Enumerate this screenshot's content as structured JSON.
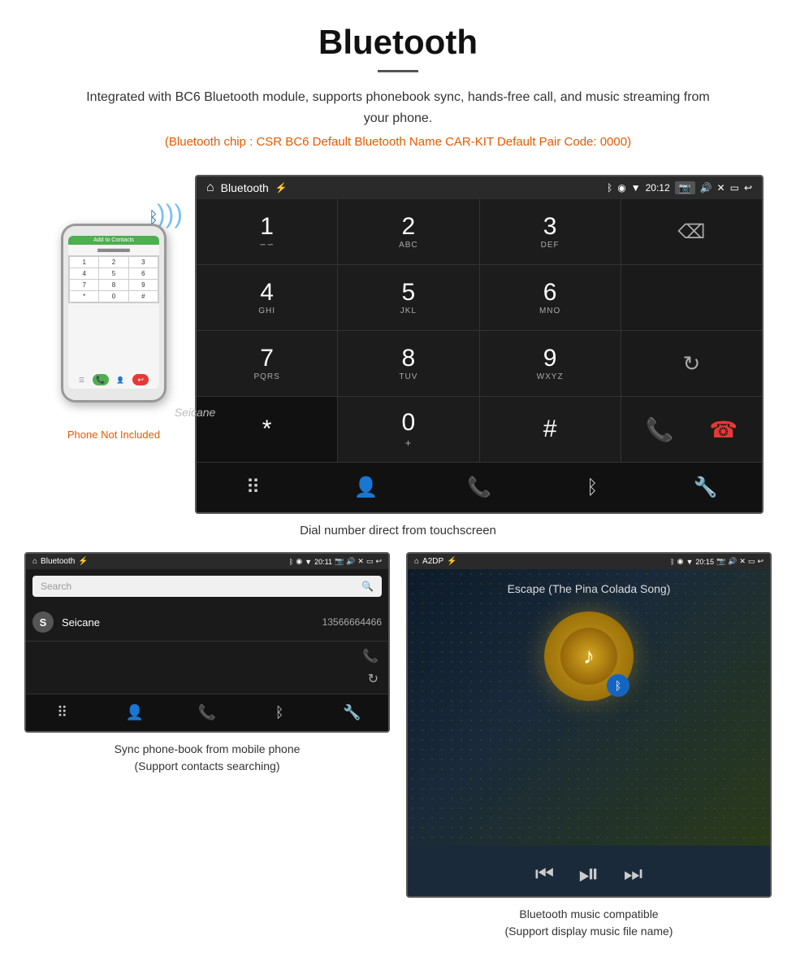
{
  "page": {
    "title": "Bluetooth",
    "divider": true,
    "description": "Integrated with BC6 Bluetooth module, supports phonebook sync, hands-free call, and music streaming from your phone.",
    "specs": "(Bluetooth chip : CSR BC6    Default Bluetooth Name CAR-KIT    Default Pair Code: 0000)"
  },
  "dialScreen": {
    "statusbar": {
      "app": "Bluetooth",
      "time": "20:12",
      "icons": "✦ ◉ ▼ 20:12"
    },
    "dialPad": [
      {
        "number": "1",
        "letters": "∿∿",
        "row": 1,
        "col": 1
      },
      {
        "number": "2",
        "letters": "ABC",
        "row": 1,
        "col": 2
      },
      {
        "number": "3",
        "letters": "DEF",
        "row": 1,
        "col": 3
      },
      {
        "number": "4",
        "letters": "GHI",
        "row": 2,
        "col": 1
      },
      {
        "number": "5",
        "letters": "JKL",
        "row": 2,
        "col": 2
      },
      {
        "number": "6",
        "letters": "MNO",
        "row": 2,
        "col": 3
      },
      {
        "number": "7",
        "letters": "PQRS",
        "row": 3,
        "col": 1
      },
      {
        "number": "8",
        "letters": "TUV",
        "row": 3,
        "col": 2
      },
      {
        "number": "9",
        "letters": "WXYZ",
        "row": 3,
        "col": 3
      },
      {
        "number": "*",
        "letters": "",
        "row": 4,
        "col": 1
      },
      {
        "number": "0",
        "letters": "+",
        "row": 4,
        "col": 2
      },
      {
        "number": "#",
        "letters": "",
        "row": 4,
        "col": 3
      }
    ],
    "caption": "Dial number direct from touchscreen"
  },
  "phonebookScreen": {
    "statusbar_app": "Bluetooth",
    "statusbar_time": "20:11",
    "search_placeholder": "Search",
    "contact": {
      "letter": "S",
      "name": "Seicane",
      "number": "13566664466"
    },
    "caption_line1": "Sync phone-book from mobile phone",
    "caption_line2": "(Support contacts searching)"
  },
  "musicScreen": {
    "statusbar_app": "A2DP",
    "statusbar_time": "20:15",
    "song_title": "Escape (The Pina Colada Song)",
    "caption_line1": "Bluetooth music compatible",
    "caption_line2": "(Support display music file name)"
  },
  "phone": {
    "not_included": "Phone Not Included",
    "screen_header": "Add to Contacts",
    "dial_cells": [
      "1",
      "2",
      "3",
      "4",
      "5",
      "6",
      "7",
      "8",
      "9",
      "*",
      "0",
      "#"
    ]
  },
  "watermark": "Seicane",
  "icons": {
    "home": "⌂",
    "back": "↩",
    "bluetooth": "⚡",
    "search": "🔍",
    "person": "👤",
    "phone": "📞",
    "bt_symbol": "ᛒ",
    "wrench": "🔧",
    "dialpad": "⠿",
    "prev": "⏮",
    "playpause": "⏯",
    "next": "⏭",
    "backspace": "⌫",
    "refresh": "↻",
    "call_green": "📞",
    "call_red": "📵"
  }
}
